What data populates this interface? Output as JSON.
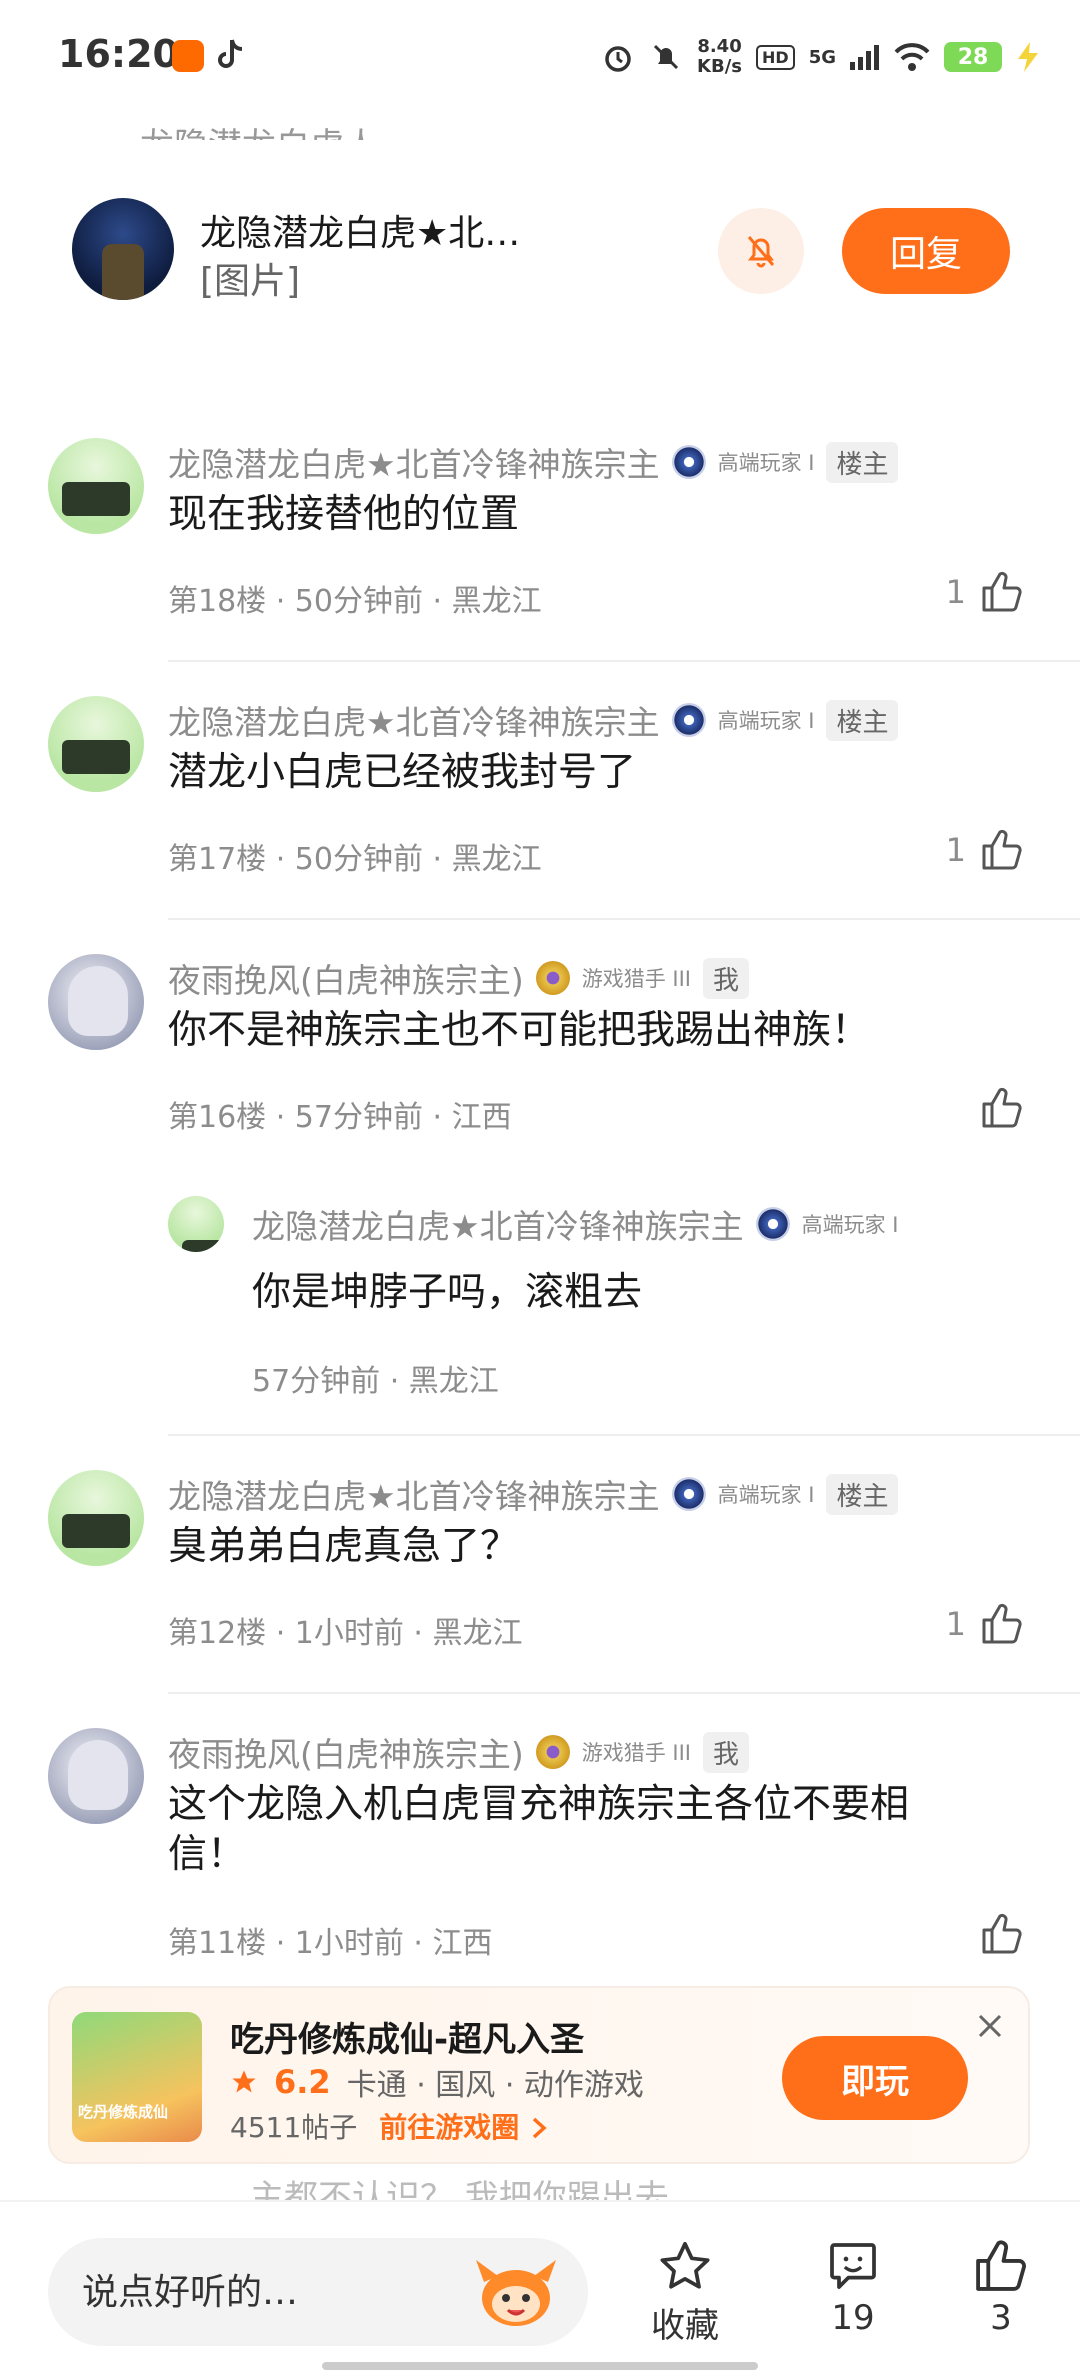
{
  "status_bar": {
    "time": "16:20",
    "net_speed_value": "8.40",
    "net_speed_unit": "KB/s",
    "hd_label": "HD",
    "signal_label": "5G",
    "battery": "28"
  },
  "header": {
    "name": "龙隐潜龙白虎★北…",
    "subtitle": "[图片]",
    "reply_label": "回复",
    "peek_text": "龙隐潜龙白虎人"
  },
  "comments": [
    {
      "name": "龙隐潜龙白虎★北首冷锋神族宗主",
      "level": "高端玩家 I",
      "tag": "楼主",
      "text": "现在我接替他的位置",
      "meta": "第18楼 · 50分钟前 · 黑龙江",
      "likes": "1"
    },
    {
      "name": "龙隐潜龙白虎★北首冷锋神族宗主",
      "level": "高端玩家 I",
      "tag": "楼主",
      "text": "潜龙小白虎已经被我封号了",
      "meta": "第17楼 · 50分钟前 · 黑龙江",
      "likes": "1"
    },
    {
      "name": "夜雨挽风(白虎神族宗主)",
      "level": "游戏猎手 III",
      "tag": "我",
      "text": "你不是神族宗主也不可能把我踢出神族！",
      "meta": "第16楼 · 57分钟前 · 江西",
      "likes": "",
      "reply": {
        "name": "龙隐潜龙白虎★北首冷锋神族宗主",
        "level": "高端玩家 I",
        "text": "你是坤脖子吗，滚粗去",
        "meta": "57分钟前 · 黑龙江"
      }
    },
    {
      "name": "龙隐潜龙白虎★北首冷锋神族宗主",
      "level": "高端玩家 I",
      "tag": "楼主",
      "text": "臭弟弟白虎真急了？",
      "meta": "第12楼 · 1小时前 · 黑龙江",
      "likes": "1"
    },
    {
      "name": "夜雨挽风(白虎神族宗主)",
      "level": "游戏猎手 III",
      "tag": "我",
      "text": "这个龙隐入机白虎冒充神族宗主各位不要相信！",
      "meta": "第11楼 · 1小时前 · 江西",
      "likes": ""
    }
  ],
  "game_card": {
    "title": "吃丹修炼成仙-超凡入圣",
    "thumb_text": "吃丹修炼成仙",
    "rating": "6.2",
    "tags": "卡通 · 国风 · 动作游戏",
    "posts": "4511帖子",
    "link": "前往游戏圈",
    "play_label": "即玩"
  },
  "peek_behind": "主都不认识？ 我把你踢出去",
  "bottom_bar": {
    "input_placeholder": "说点好听的…",
    "favorite_label": "收藏",
    "comment_count": "19",
    "like_count": "3"
  },
  "colors": {
    "accent": "#ff6f1a",
    "muted_text": "#8c8c8c"
  }
}
